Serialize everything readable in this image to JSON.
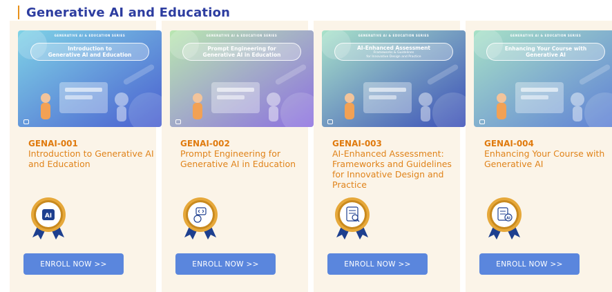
{
  "section": {
    "title": "Generative AI and Education"
  },
  "banner_series": "GENERATIVE AI & EDUCATION SERIES",
  "cards": [
    {
      "code": "GENAI-001",
      "title": "Introduction to Generative AI and Education",
      "banner_lines": [
        "Introduction to",
        "Generative AI and Education"
      ],
      "banner_sub": [],
      "badge_icon": "ai-chip-icon",
      "button": "ENROLL NOW >>",
      "theme": [
        "#7fd3e6",
        "#4a5fd0"
      ]
    },
    {
      "code": "GENAI-002",
      "title": "Prompt Engineering for Generative AI in Education",
      "banner_lines": [
        "Prompt Engineering for",
        "Generative AI in Education"
      ],
      "banner_sub": [],
      "badge_icon": "prompt-brain-icon",
      "button": "ENROLL NOW >>",
      "theme": [
        "#b9e7b0",
        "#8c6fe0"
      ]
    },
    {
      "code": "GENAI-003",
      "title": "AI-Enhanced Assessment: Frameworks and Guidelines for Innovative Design and Practice",
      "banner_lines": [
        "AI-Enhanced Assessment"
      ],
      "banner_sub": [
        "Frameworks & Guidelines",
        "for Innovative Design and Practice"
      ],
      "badge_icon": "assessment-doc-icon",
      "button": "ENROLL NOW >>",
      "theme": [
        "#a9e3c9",
        "#3b4fb8"
      ]
    },
    {
      "code": "GENAI-004",
      "title": "Enhancing Your Course with Generative AI",
      "banner_lines": [
        "Enhancing Your Course with",
        "Generative AI"
      ],
      "banner_sub": [],
      "badge_icon": "course-ai-icon",
      "button": "ENROLL NOW >>",
      "theme": [
        "#a7e1c6",
        "#5e7fd6"
      ]
    }
  ]
}
